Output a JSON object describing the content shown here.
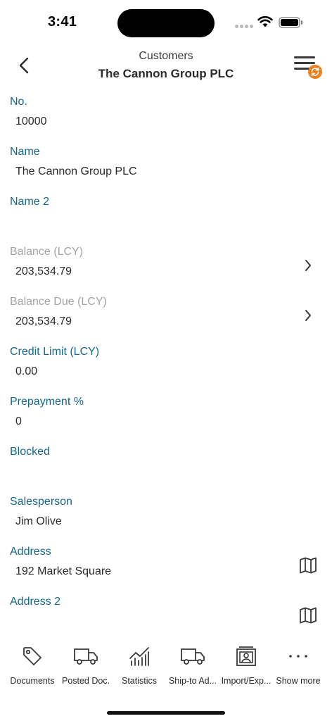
{
  "status_bar": {
    "time": "3:41"
  },
  "header": {
    "subtitle": "Customers",
    "title": "The Cannon Group PLC"
  },
  "fields": [
    {
      "label": "No.",
      "value": "10000",
      "muted": false,
      "action": ""
    },
    {
      "label": "Name",
      "value": "The Cannon Group PLC",
      "muted": false,
      "action": ""
    },
    {
      "label": "Name 2",
      "value": "",
      "muted": false,
      "action": ""
    },
    {
      "label": "Balance (LCY)",
      "value": "203,534.79",
      "muted": true,
      "action": "chevron-right-icon"
    },
    {
      "label": "Balance Due (LCY)",
      "value": "203,534.79",
      "muted": true,
      "action": "chevron-right-icon"
    },
    {
      "label": "Credit Limit (LCY)",
      "value": "0.00",
      "muted": false,
      "action": ""
    },
    {
      "label": "Prepayment %",
      "value": "0",
      "muted": false,
      "action": ""
    },
    {
      "label": "Blocked",
      "value": "",
      "muted": false,
      "action": ""
    },
    {
      "label": "Salesperson",
      "value": "Jim Olive",
      "muted": false,
      "action": ""
    },
    {
      "label": "Address",
      "value": "192 Market Square",
      "muted": false,
      "action": "map-icon"
    },
    {
      "label": "Address 2",
      "value": "",
      "muted": false,
      "action": "map-icon"
    }
  ],
  "toolbar": {
    "documents": "Documents",
    "posted_doc": "Posted Doc.",
    "statistics": "Statistics",
    "ship_to": "Ship-to Ad...",
    "import_export": "Import/Exp...",
    "show_more": "Show more"
  },
  "colors": {
    "label": "#15688a",
    "muted_label": "#a3a3a3",
    "badge": "#e8821e"
  }
}
